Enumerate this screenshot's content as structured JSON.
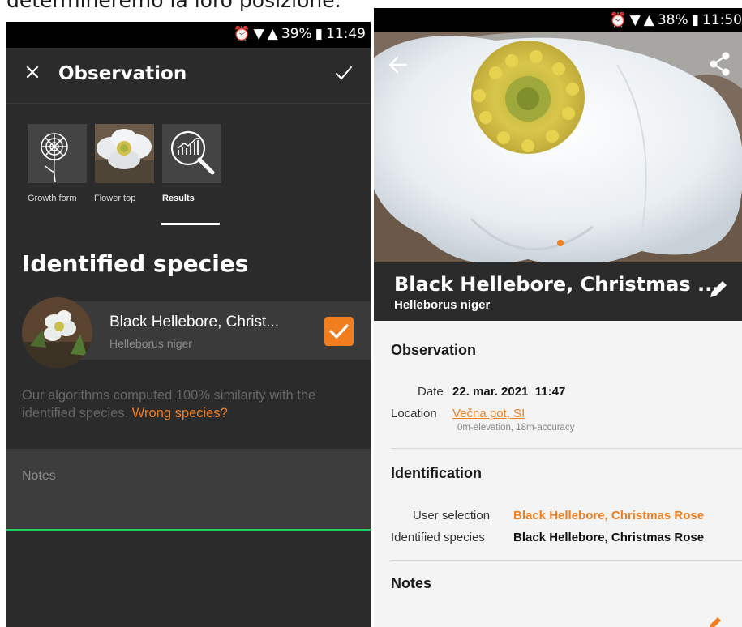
{
  "document": {
    "top_text": "determineremo la loro posizione."
  },
  "left": {
    "status": {
      "battery": "39%",
      "time": "11:49"
    },
    "toolbar": {
      "title": "Observation"
    },
    "tabs": [
      {
        "label": "Growth form",
        "icon": "dandelion-icon"
      },
      {
        "label": "Flower top",
        "icon": "flower-photo"
      },
      {
        "label": "Results",
        "icon": "results-magnifier-icon"
      }
    ],
    "identified_title": "Identified species",
    "species": {
      "name": "Black Hellebore, Christ...",
      "latin": "Helleborus niger",
      "selected": true
    },
    "algorithm_text": "Our algorithms computed 100% similarity with the identified species.",
    "wrong_species": "Wrong species?",
    "notes_label": "Notes",
    "colors": {
      "accent": "#f07d1e",
      "input_underline": "#1fd160",
      "background": "#2b2b2b"
    }
  },
  "right": {
    "status": {
      "battery": "38%",
      "time": "11:50"
    },
    "header": {
      "common_name": "Black Hellebore, Christmas ...",
      "latin_name": "Helleborus niger"
    },
    "observation": {
      "title": "Observation",
      "date_label": "Date",
      "date_value": "22. mar. 2021  11:47",
      "location_label": "Location",
      "location_value": "Večna pot, SI",
      "location_detail": "0m-elevation, 18m-accuracy"
    },
    "identification": {
      "title": "Identification",
      "user_selection_label": "User selection",
      "user_selection_value": "Black Hellebore, Christmas Rose",
      "identified_label": "Identified species",
      "identified_value": "Black Hellebore, Christmas Rose"
    },
    "notes_title": "Notes"
  }
}
